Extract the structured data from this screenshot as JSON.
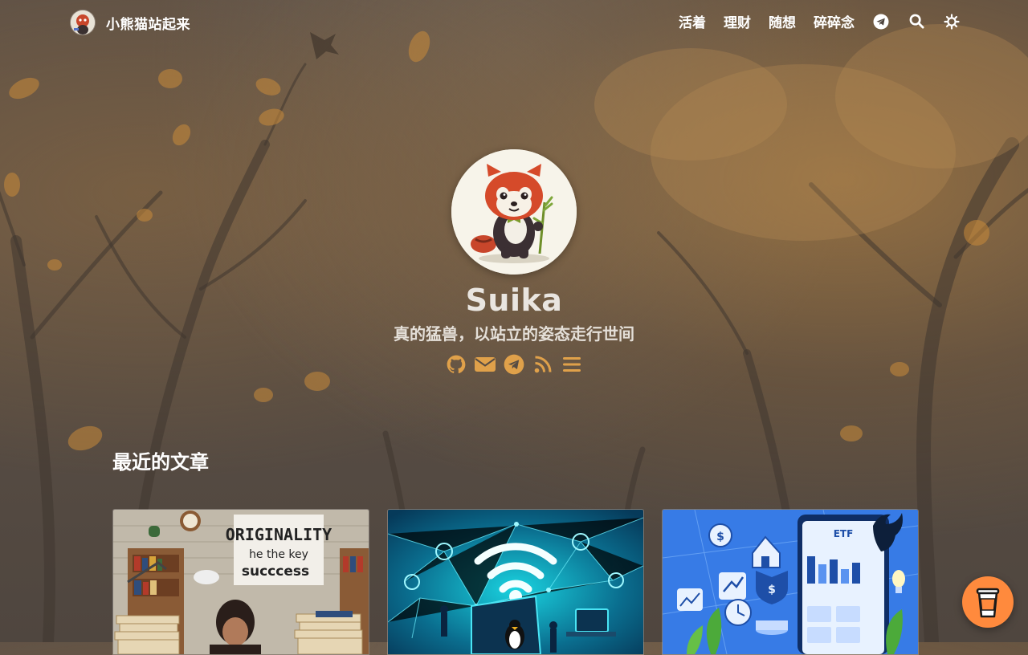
{
  "site": {
    "title": "小熊猫站起来"
  },
  "nav": {
    "items": [
      {
        "label": "活着"
      },
      {
        "label": "理财"
      },
      {
        "label": "随想"
      },
      {
        "label": "碎碎念"
      }
    ],
    "icons": [
      "telegram-icon",
      "search-icon",
      "theme-toggle-icon"
    ]
  },
  "profile": {
    "name": "Suika",
    "tagline": "真的猛兽，以站立的姿态走行世间",
    "social_icons": [
      "github-icon",
      "email-icon",
      "telegram-icon",
      "rss-icon",
      "menu-icon"
    ]
  },
  "recent": {
    "title": "最近的文章",
    "cards": [
      {
        "image_text_1": "ORIGINALITY",
        "image_text_2": "he the key",
        "image_text_3": "succcess"
      },
      {
        "image_text_1": ""
      },
      {
        "image_text_1": "ETF"
      }
    ]
  },
  "colors": {
    "accent": "#e0a14a",
    "coffee_button": "#ff8a3d"
  }
}
